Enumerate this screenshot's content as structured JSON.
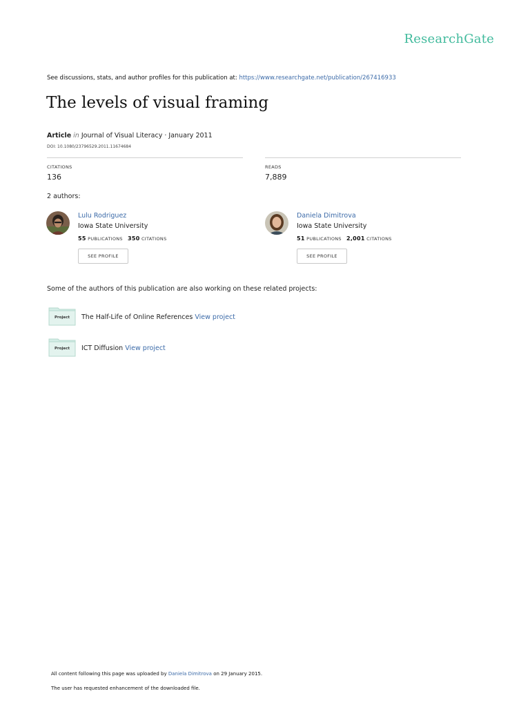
{
  "brand": {
    "name": "ResearchGate"
  },
  "discussions": {
    "text": "See discussions, stats, and author profiles for this publication at:",
    "url": "https://www.researchgate.net/publication/267416933"
  },
  "publication": {
    "title": "The levels of visual framing",
    "type": "Article",
    "in_word": "in",
    "journal_date": "Journal of Visual Literacy · January 2011",
    "doi": "DOI: 10.1080/23796529.2011.11674684"
  },
  "stats": {
    "citations_label": "CITATIONS",
    "citations_value": "136",
    "reads_label": "READS",
    "reads_value": "7,889"
  },
  "authors_heading": "2 authors:",
  "authors": [
    {
      "name": "Lulu Rodriguez",
      "institution": "Iowa State University",
      "publications_count": "55",
      "publications_label": "PUBLICATIONS",
      "citations_count": "350",
      "citations_label": "CITATIONS",
      "button_label": "SEE PROFILE"
    },
    {
      "name": "Daniela Dimitrova",
      "institution": "Iowa State University",
      "publications_count": "51",
      "publications_label": "PUBLICATIONS",
      "citations_count": "2,001",
      "citations_label": "CITATIONS",
      "button_label": "SEE PROFILE"
    }
  ],
  "projects_heading": "Some of the authors of this publication are also working on these related projects:",
  "projects": [
    {
      "badge": "Project",
      "name": "The Half-Life of Online References",
      "link_label": "View project"
    },
    {
      "badge": "Project",
      "name": "ICT Diffusion",
      "link_label": "View project"
    }
  ],
  "footer": {
    "uploaded_prefix": "All content following this page was uploaded by",
    "uploader": "Daniela Dimitrova",
    "uploaded_suffix": "on 29 January 2015.",
    "enhancement_note": "The user has requested enhancement of the downloaded file."
  },
  "colors": {
    "brand": "#40ba9c",
    "link": "#3b6aa8",
    "folder": "#d4ede6"
  }
}
